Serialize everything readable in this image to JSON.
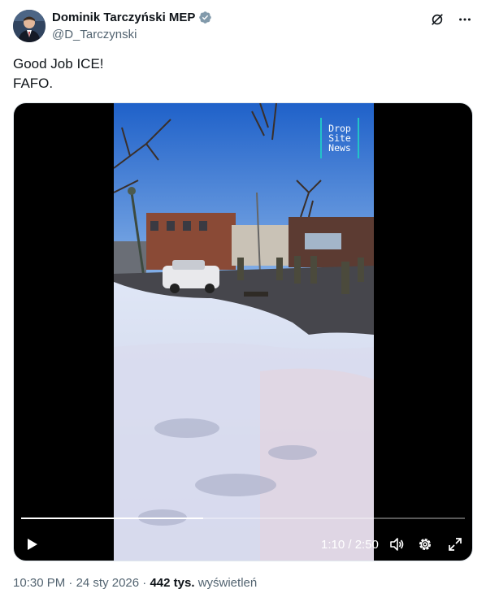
{
  "author": {
    "display_name": "Dominik Tarczyński MEP",
    "handle": "@D_Tarczynski",
    "verified": true
  },
  "header_icons": [
    "grok-icon",
    "more-icon"
  ],
  "tweet": {
    "lines": [
      "Good Job ICE!",
      "FAFO."
    ]
  },
  "video": {
    "watermark": [
      "Drop",
      "Site",
      "News"
    ],
    "current_time": "1:10",
    "duration": "2:50",
    "time_display": "1:10 / 2:50",
    "progress": 0.41
  },
  "footer": {
    "time": "10:30 PM",
    "date": "24 sty 2026",
    "views_count": "442 tys.",
    "views_label": "wyświetleń"
  },
  "colors": {
    "text": "#0f1419",
    "secondary": "#536471",
    "verified": "#829aab",
    "watermark_accent": "#23c3c9"
  }
}
